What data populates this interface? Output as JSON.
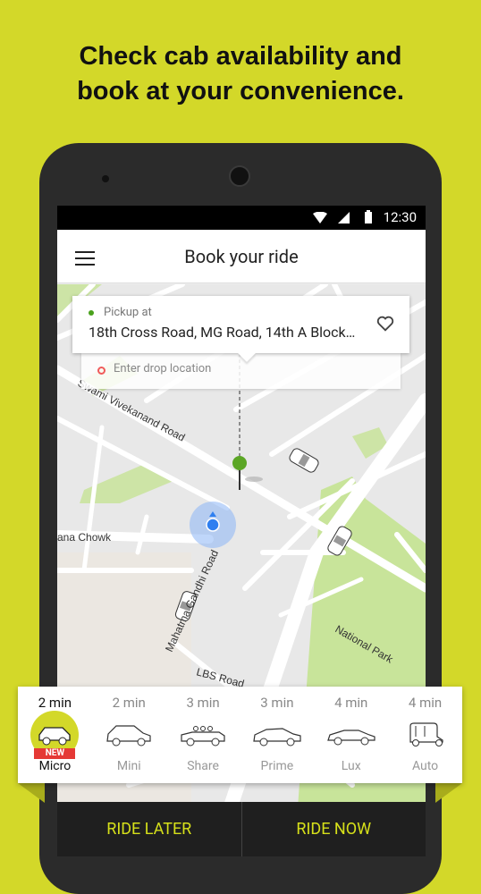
{
  "headline": {
    "line1": "Check cab availability and",
    "line2": "book at your convenience."
  },
  "status_bar": {
    "time": "12:30",
    "icons": [
      "wifi-icon",
      "signal-icon",
      "battery-icon"
    ]
  },
  "app_bar": {
    "title": "Book your ride",
    "menu_icon": "hamburger-menu-icon"
  },
  "location_card": {
    "pickup_label": "Pickup at",
    "pickup_address": "18th Cross Road, MG Road, 14th A Block…",
    "favorite_icon": "heart-icon",
    "drop_placeholder": "Enter drop location"
  },
  "map": {
    "labels": {
      "road1": "Swami Vivekanand Road",
      "road2": "ana Chowk",
      "road3": "Mahatma Gandhi Road",
      "road4": "LBS Road",
      "park": "National Park"
    }
  },
  "vehicles": [
    {
      "eta": "2 min",
      "name": "Micro",
      "badge": "NEW",
      "selected": true
    },
    {
      "eta": "2 min",
      "name": "Mini"
    },
    {
      "eta": "3 min",
      "name": "Share"
    },
    {
      "eta": "3 min",
      "name": "Prime"
    },
    {
      "eta": "4 min",
      "name": "Lux"
    },
    {
      "eta": "4 min",
      "name": "Auto"
    }
  ],
  "actions": {
    "ride_later": "RIDE LATER",
    "ride_now": "RIDE NOW"
  },
  "colors": {
    "brand": "#d3d829",
    "pickup": "#4aa11d",
    "drop": "#f05a5a",
    "button_text": "#d6e01a"
  }
}
